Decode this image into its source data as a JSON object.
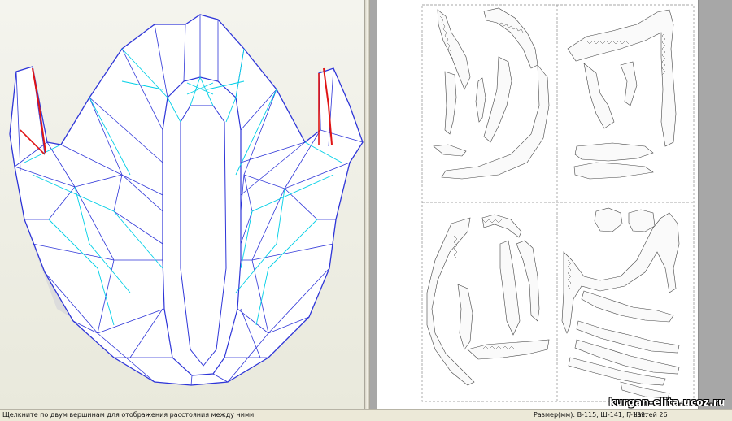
{
  "status": {
    "hint": "Щелкните по двум вершинам для отображения расстояния между ними.",
    "size": "Размер(мм): В-115, Ш-141, Г-139.",
    "parts": "/ Частей 26"
  },
  "watermark": "kurgan-elita.ucoz.ru",
  "colors": {
    "wire": "#2e35d8",
    "fold": "#00cfe6",
    "edge_red": "#e01414",
    "paper_bg": "#ffffff",
    "grey_bg": "#a7a7a7"
  }
}
